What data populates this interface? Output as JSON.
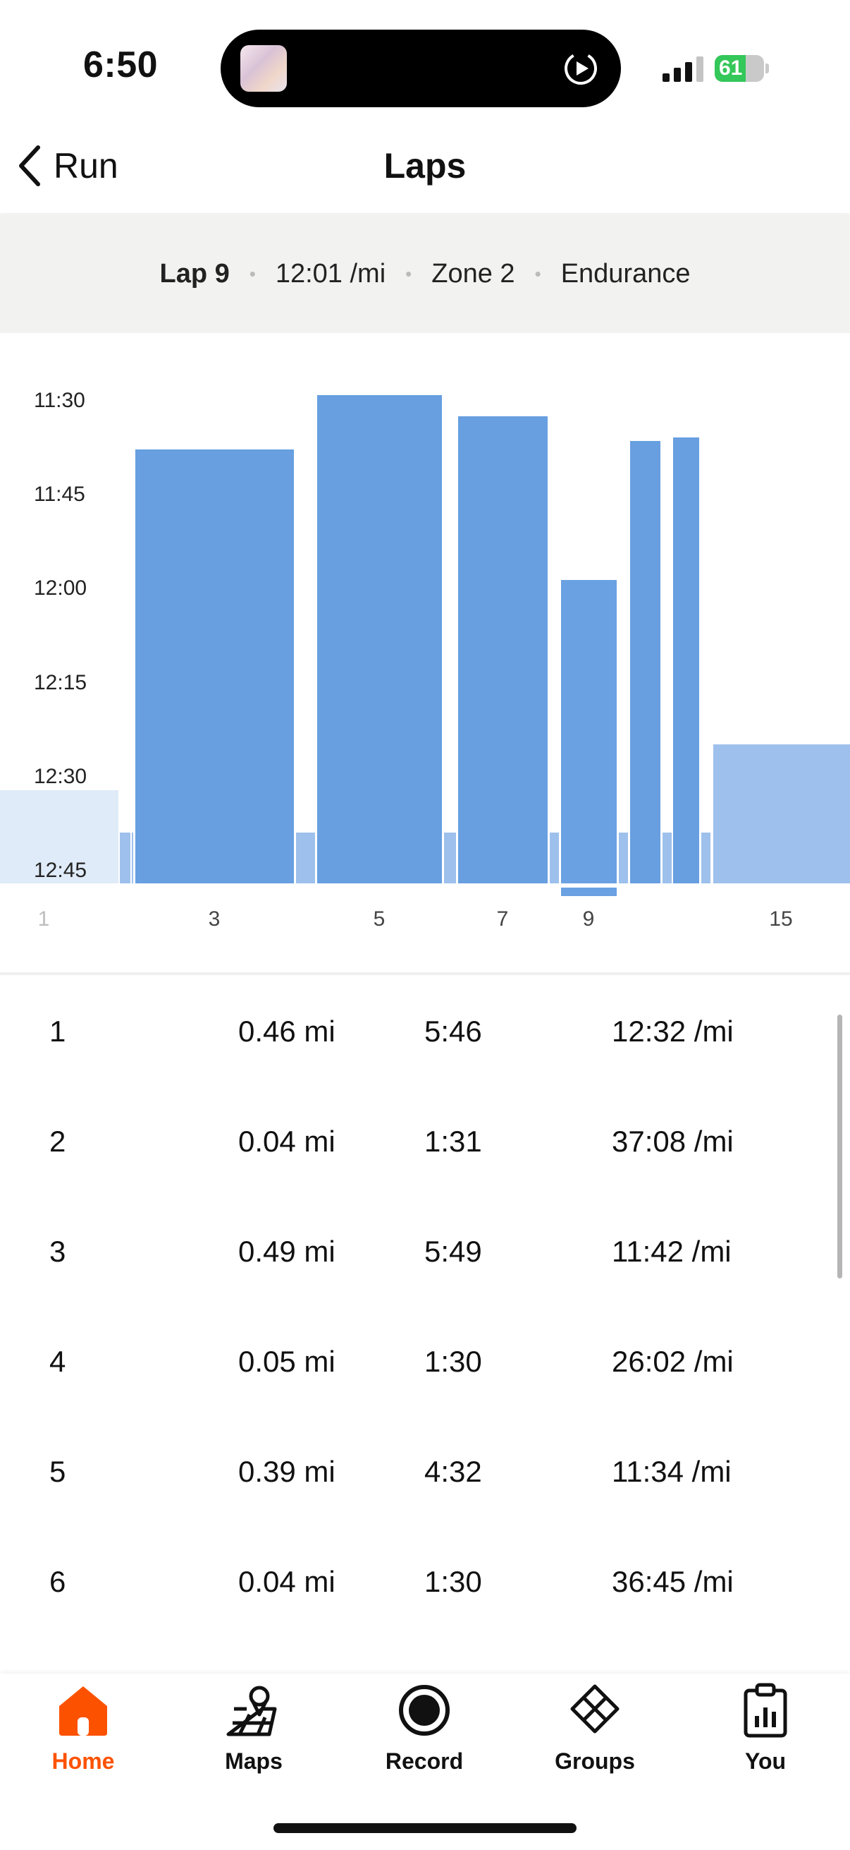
{
  "status": {
    "time": "6:50",
    "battery": "61"
  },
  "nav": {
    "back_label": "Run",
    "title": "Laps"
  },
  "summary": {
    "lap": "Lap 9",
    "pace": "12:01 /mi",
    "zone": "Zone 2",
    "type": "Endurance"
  },
  "chart_data": {
    "type": "bar",
    "y_ticks": [
      "11:30",
      "11:45",
      "12:00",
      "12:15",
      "12:30",
      "12:45"
    ],
    "x_ticks": [
      "1",
      "3",
      "5",
      "7",
      "9",
      "15"
    ],
    "selected_lap": "9",
    "colors": {
      "bar": "#679fe0",
      "bar_light": "#9ec0ec",
      "bar_faint": "#dfebf8",
      "selected": "#6aa1e2"
    }
  },
  "laps": [
    {
      "num": "1",
      "distance": "0.46 mi",
      "time": "5:46",
      "pace": "12:32 /mi"
    },
    {
      "num": "2",
      "distance": "0.04 mi",
      "time": "1:31",
      "pace": "37:08 /mi"
    },
    {
      "num": "3",
      "distance": "0.49 mi",
      "time": "5:49",
      "pace": "11:42 /mi"
    },
    {
      "num": "4",
      "distance": "0.05 mi",
      "time": "1:30",
      "pace": "26:02 /mi"
    },
    {
      "num": "5",
      "distance": "0.39 mi",
      "time": "4:32",
      "pace": "11:34 /mi"
    },
    {
      "num": "6",
      "distance": "0.04 mi",
      "time": "1:30",
      "pace": "36:45 /mi"
    }
  ],
  "tabs": [
    {
      "label": "Home",
      "icon": "home-icon",
      "active": true
    },
    {
      "label": "Maps",
      "icon": "maps-icon",
      "active": false
    },
    {
      "label": "Record",
      "icon": "record-icon",
      "active": false
    },
    {
      "label": "Groups",
      "icon": "groups-icon",
      "active": false
    },
    {
      "label": "You",
      "icon": "you-icon",
      "active": false
    }
  ],
  "accent": "#fc5200"
}
